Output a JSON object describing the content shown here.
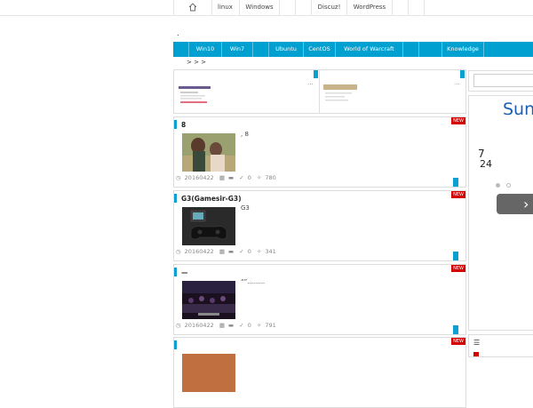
{
  "topnav": {
    "items": [
      "linux",
      "Windows",
      "Discuz!",
      "WordPress"
    ]
  },
  "page_marker": ".",
  "categories": [
    "Win10",
    "Win7",
    "Ubuntu",
    "CentOS",
    "World of Warcraft",
    "Knowledge"
  ],
  "breadcrumb": ">   >   >",
  "top_posts": {
    "more": "···"
  },
  "articles": [
    {
      "title": "8",
      "excerpt": ", 8",
      "date": "20160422",
      "comments": "0",
      "views": "780",
      "badge": "NEW"
    },
    {
      "title": "G3(Gamesir-G3)",
      "excerpt": "G3",
      "date": "20160422",
      "comments": "0",
      "views": "341",
      "badge": "NEW"
    },
    {
      "title": "—",
      "excerpt": "“”.........",
      "date": "20160422",
      "comments": "0",
      "views": "791",
      "badge": "NEW"
    },
    {
      "title": "",
      "excerpt": "",
      "date": "",
      "comments": "",
      "views": "",
      "badge": "NEW"
    }
  ],
  "sidebar": {
    "brand": "Sun",
    "num1": "7",
    "num2": "24",
    "next": "›"
  },
  "colors": {
    "accent": "#00a0d0",
    "new_badge": "#d40000",
    "brand": "#1a5fb4"
  }
}
